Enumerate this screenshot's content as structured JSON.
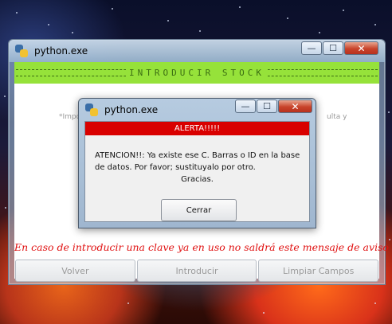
{
  "main_window": {
    "title": "python.exe",
    "banner_title": "INTRODUCIR STOCK",
    "hidden_text_left": "*Impo",
    "hidden_text_right": "ulta y",
    "warning": "En caso de introducir una clave ya en uso no saldrá este mensaje de aviso",
    "buttons": [
      "Volver",
      "Introducir",
      "Limpiar Campos"
    ],
    "controls": {
      "minimize": "—",
      "maximize": "☐",
      "close": "✕"
    }
  },
  "alert_window": {
    "title": "python.exe",
    "banner": "ALERTA!!!!!",
    "message_line1": "ATENCION!!: Ya existe ese C. Barras o ID en la base",
    "message_line2": "de datos. Por favor; sustituyalo por otro.",
    "message_line3": "Gracias.",
    "close_button": "Cerrar",
    "controls": {
      "minimize": "—",
      "maximize": "☐",
      "close": "✕"
    }
  },
  "colors": {
    "banner_green": "#96e23a",
    "alert_red": "#d90000",
    "warning_red": "#e01010"
  },
  "icons": [
    "python-icon",
    "minimize-icon",
    "maximize-icon",
    "close-icon"
  ]
}
